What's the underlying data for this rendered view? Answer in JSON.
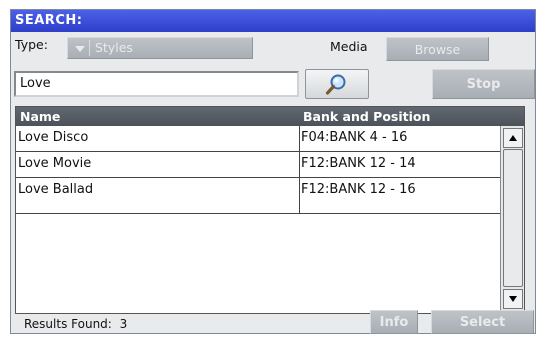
{
  "window": {
    "title": "SEARCH:"
  },
  "type_row": {
    "type_label": "Type:",
    "type_value": "Styles",
    "media_label": "Media",
    "browse_label": "Browse"
  },
  "search": {
    "value": "Love",
    "stop_label": "Stop",
    "search_icon": "magnifier-icon"
  },
  "table": {
    "headers": [
      "Name",
      "Bank and Position"
    ],
    "rows": [
      [
        "Love Disco",
        "F04:BANK 4 - 16"
      ],
      [
        "Love Movie",
        "F12:BANK 12 - 14"
      ],
      [
        "Love Ballad",
        "F12:BANK 12 - 16"
      ]
    ]
  },
  "footer": {
    "results_label": "Results Found:",
    "results_count": "3",
    "info_label": "Info",
    "select_label": "Select"
  },
  "colors": {
    "title_bar": "#3a4fe0",
    "panel": "#e8eaec",
    "disabled_button": "#b3b7bd"
  }
}
